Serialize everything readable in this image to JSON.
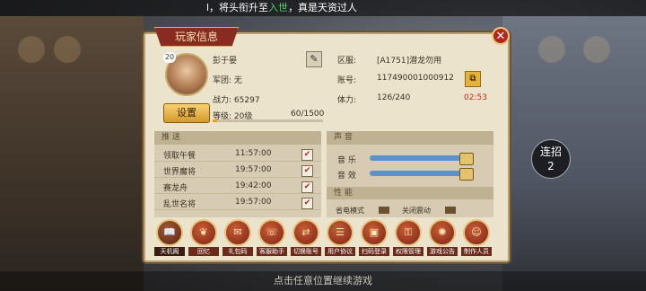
{
  "marquee": {
    "pre": "l，将头衔升至",
    "highlight": "入世",
    "post": "，真是天资过人"
  },
  "bottom_hint": "点击任意位置继续游戏",
  "combo": {
    "label": "连招",
    "count": "2"
  },
  "panel": {
    "title": "玩家信息",
    "player": {
      "level_badge": "20",
      "name": "彭于晏",
      "guild_label": "军团:",
      "guild": "无",
      "power_label": "战力:",
      "power": "65297",
      "server_label": "区服:",
      "server": "[A1751]潜龙勿用",
      "account_label": "账号:",
      "account": "117490001000912",
      "stamina_label": "体力:",
      "stamina": "126/240",
      "stamina_timer": "02:53",
      "grade_label": "等级:",
      "grade": "20级",
      "exp": "60/1500",
      "exp_fraction": 0.04
    },
    "settings_label": "设置",
    "push": {
      "header": "推 送",
      "rows": [
        {
          "name": "领取午餐",
          "time": "11:57:00",
          "checked": true
        },
        {
          "name": "世界魔将",
          "time": "19:57:00",
          "checked": true
        },
        {
          "name": "赛龙舟",
          "time": "19:42:00",
          "checked": true
        },
        {
          "name": "乱世名将",
          "time": "19:57:00",
          "checked": true
        }
      ]
    },
    "sound": {
      "header": "声 音",
      "music_label": "音 乐",
      "music_level": 1.0,
      "effects_label": "音 效",
      "effects_level": 1.0
    },
    "performance": {
      "header": "性 能",
      "power_save": "省电模式",
      "vibration_off": "关闭震动"
    },
    "icons": [
      {
        "label": "天机阁",
        "icon": "book-icon"
      },
      {
        "label": "回忆",
        "icon": "leaf-icon"
      },
      {
        "label": "礼包码",
        "icon": "ticket-icon"
      },
      {
        "label": "客服助手",
        "icon": "chat-icon"
      },
      {
        "label": "切换账号",
        "icon": "swap-icon"
      },
      {
        "label": "用户协议",
        "icon": "document-icon"
      },
      {
        "label": "扫码登录",
        "icon": "scan-icon"
      },
      {
        "label": "权限管理",
        "icon": "lock-icon"
      },
      {
        "label": "游戏公告",
        "icon": "megaphone-icon"
      },
      {
        "label": "制作人员",
        "icon": "people-icon"
      }
    ]
  },
  "colors": {
    "accent_red": "#c42a1c",
    "gold": "#e5c27a",
    "panel_bg": "#ece3cc"
  }
}
